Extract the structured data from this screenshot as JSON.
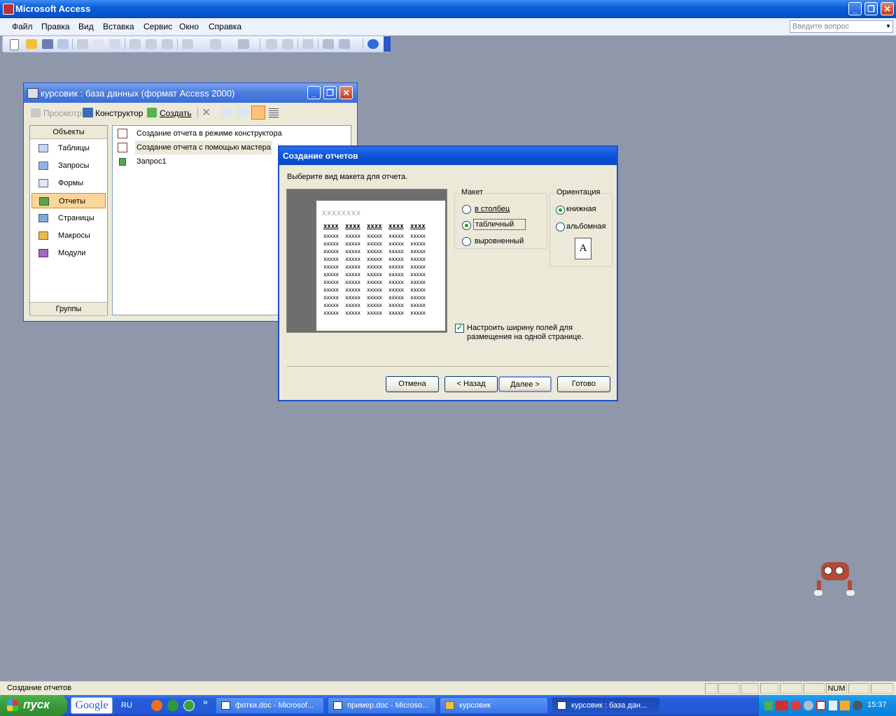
{
  "app": {
    "title": "Microsoft Access",
    "window_controls": {
      "minimize": "_",
      "restore": "❐",
      "close": "✕"
    }
  },
  "menu": {
    "items": [
      "Файл",
      "Правка",
      "Вид",
      "Вставка",
      "Сервис",
      "Окно",
      "Справка"
    ],
    "ask_placeholder": "Введите вопрос"
  },
  "db_window": {
    "title": "курсовик : база данных (формат Access 2000)",
    "toolbar": {
      "preview": "Просмотр",
      "design": "Конструктор",
      "create": "Создать"
    },
    "objects_header": "Объекты",
    "groups_header": "Группы",
    "objects": [
      "Таблицы",
      "Запросы",
      "Формы",
      "Отчеты",
      "Страницы",
      "Макросы",
      "Модули"
    ],
    "selected_object": "Отчеты",
    "list": [
      "Создание отчета в режиме конструктора",
      "Создание отчета с помощью мастера",
      "Запрос1"
    ]
  },
  "dialog": {
    "title": "Создание отчетов",
    "prompt": "Выберите вид макета для отчета.",
    "preview": {
      "title_placeholder": "xxxxxxxx",
      "col_header": "xxxx",
      "cell": "xxxxx"
    },
    "layout": {
      "label": "Макет",
      "options": [
        "в столбец",
        "табличный",
        "выровненный"
      ],
      "selected": "табличный"
    },
    "orientation": {
      "label": "Ориентация",
      "options": [
        "книжная",
        "альбомная"
      ],
      "selected": "книжная",
      "page_letter": "A"
    },
    "fit_checkbox": {
      "label_line1": "Настроить ширину полей для",
      "label_line2": "размещения на одной странице.",
      "checked": true
    },
    "buttons": {
      "cancel": "Отмена",
      "back": "< Назад",
      "next": "Далее >",
      "finish": "Готово"
    }
  },
  "statusbar": {
    "text": "Создание отчетов",
    "num": "NUM"
  },
  "taskbar": {
    "start": "пуск",
    "google": "Google",
    "lang": "RU",
    "chevron": "»",
    "tasks": [
      {
        "label": "фотки.doc - Microsof...",
        "active": false
      },
      {
        "label": "пример.doc - Microso...",
        "active": false
      },
      {
        "label": "курсовик",
        "active": false
      },
      {
        "label": "курсовик : база дан...",
        "active": true
      }
    ],
    "clock": "15:37"
  }
}
